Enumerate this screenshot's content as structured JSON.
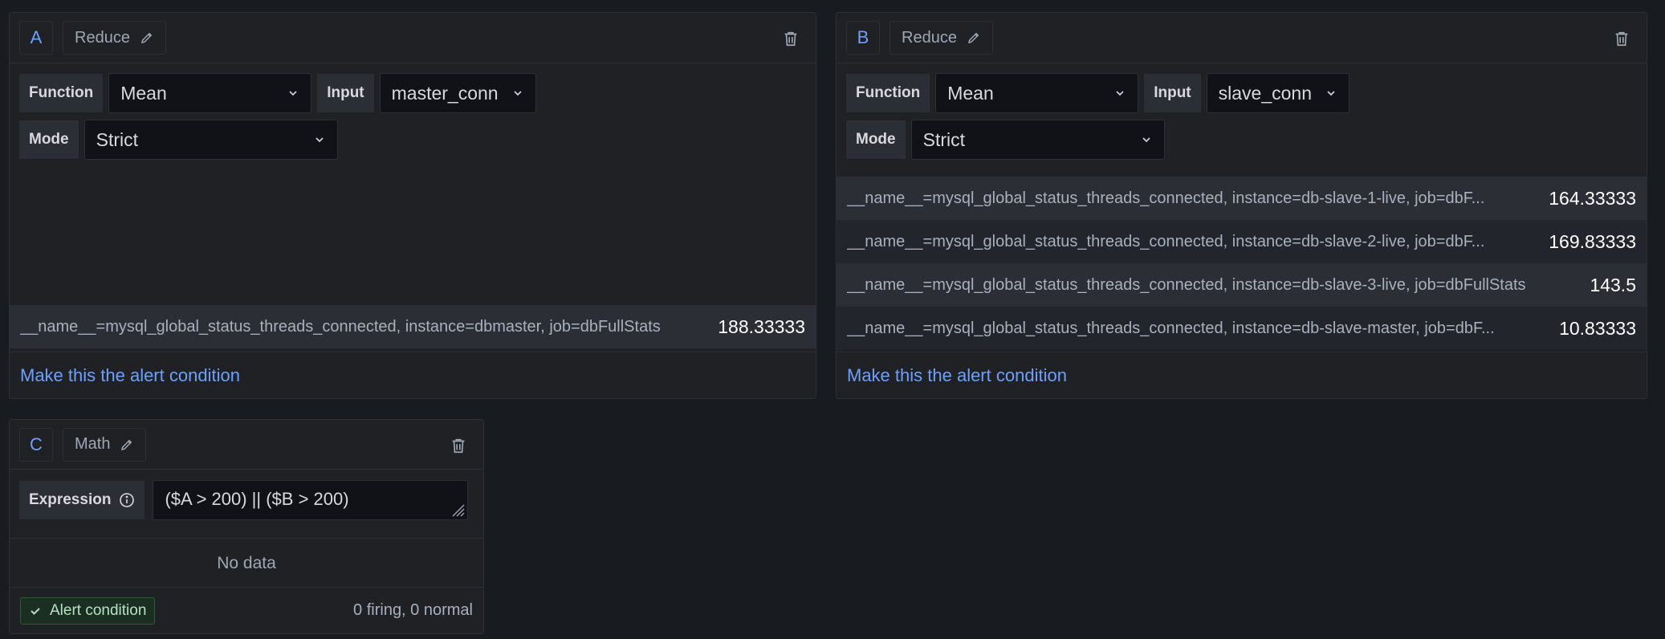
{
  "queries": {
    "a": {
      "ref_id": "A",
      "type": "Reduce",
      "function_label": "Function",
      "function_value": "Mean",
      "input_label": "Input",
      "input_value": "master_conn",
      "mode_label": "Mode",
      "mode_value": "Strict",
      "results": [
        {
          "label": "__name__=mysql_global_status_threads_connected, instance=dbmaster, job=dbFullStats",
          "value": "188.33333"
        }
      ],
      "alert_link": "Make this the alert condition"
    },
    "b": {
      "ref_id": "B",
      "type": "Reduce",
      "function_label": "Function",
      "function_value": "Mean",
      "input_label": "Input",
      "input_value": "slave_conn",
      "mode_label": "Mode",
      "mode_value": "Strict",
      "results": [
        {
          "label": "__name__=mysql_global_status_threads_connected, instance=db-slave-1-live, job=dbF...",
          "value": "164.33333"
        },
        {
          "label": "__name__=mysql_global_status_threads_connected, instance=db-slave-2-live, job=dbF...",
          "value": "169.83333"
        },
        {
          "label": "__name__=mysql_global_status_threads_connected, instance=db-slave-3-live, job=dbFullStats",
          "value": "143.5"
        },
        {
          "label": "__name__=mysql_global_status_threads_connected, instance=db-slave-master, job=dbF...",
          "value": "10.83333"
        }
      ],
      "alert_link": "Make this the alert condition"
    },
    "c": {
      "ref_id": "C",
      "type": "Math",
      "expression_label": "Expression",
      "expression_value": "($A > 200) || ($B > 200)",
      "no_data": "No data",
      "alert_badge": "Alert condition",
      "firing_status": "0 firing, 0 normal"
    }
  },
  "colors": {
    "background": "#181b1f",
    "panel": "#1f2125",
    "accent_blue": "#6e9fff",
    "success": "#b9e0c4"
  },
  "icons": [
    "pencil-icon",
    "trash-icon",
    "chevron-down-icon",
    "info-icon",
    "check-icon",
    "resize-grip-icon"
  ]
}
